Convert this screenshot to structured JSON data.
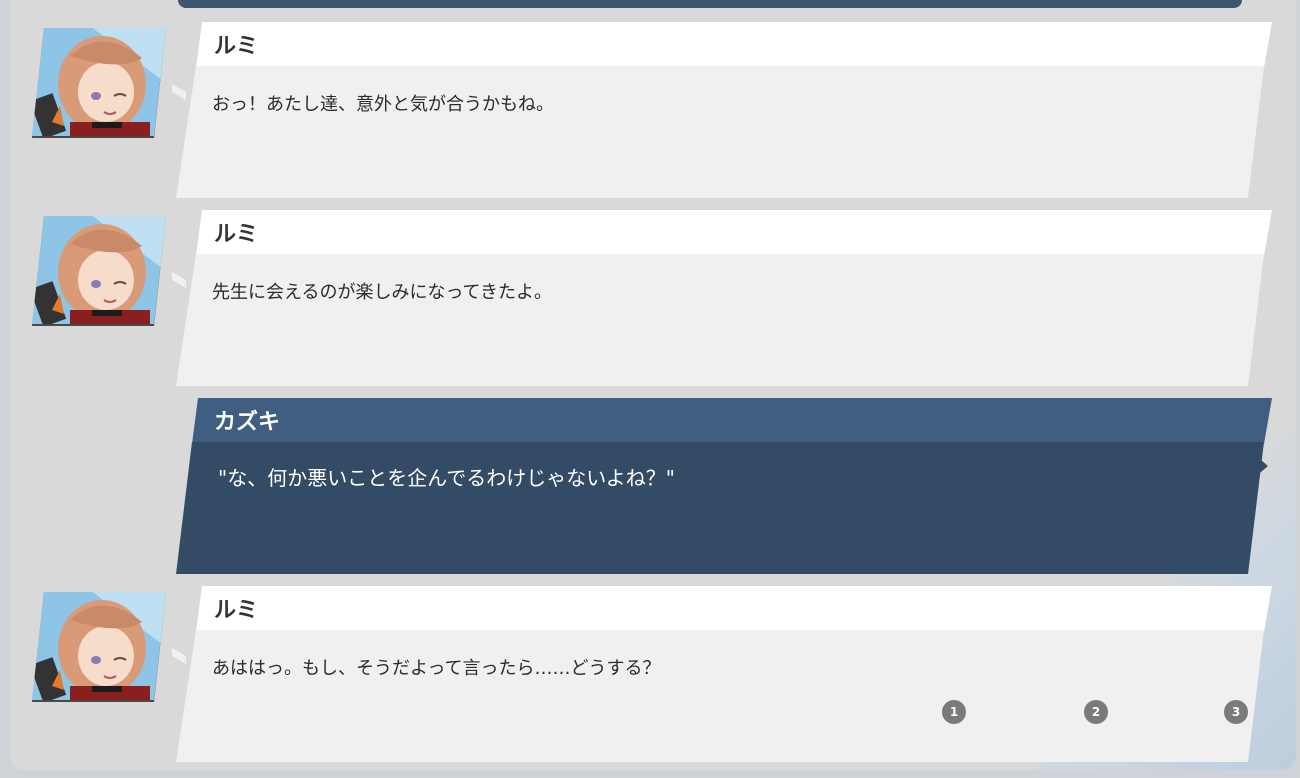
{
  "messages": [
    {
      "speaker": "ルミ",
      "text": "おっ！あたし達、意外と気が合うかもね。",
      "side": "npc"
    },
    {
      "speaker": "ルミ",
      "text": "先生に会えるのが楽しみになってきたよ。",
      "side": "npc"
    },
    {
      "speaker": "カズキ",
      "text": "\"な、何か悪いことを企んでるわけじゃないよね？\"",
      "side": "player"
    },
    {
      "speaker": "ルミ",
      "text": "あははっ。もし、そうだよって言ったら……どうする？",
      "side": "npc"
    }
  ],
  "choices": [
    "1",
    "2",
    "3"
  ],
  "colors": {
    "npc_header": "#ffffff",
    "npc_body": "#f0f0f0",
    "player_header": "#3f5e82",
    "player_body": "#344b66",
    "frame": "#d9d9d9"
  },
  "icons": {
    "avatar": "character-portrait-rumi",
    "choice": "numbered-circle"
  }
}
